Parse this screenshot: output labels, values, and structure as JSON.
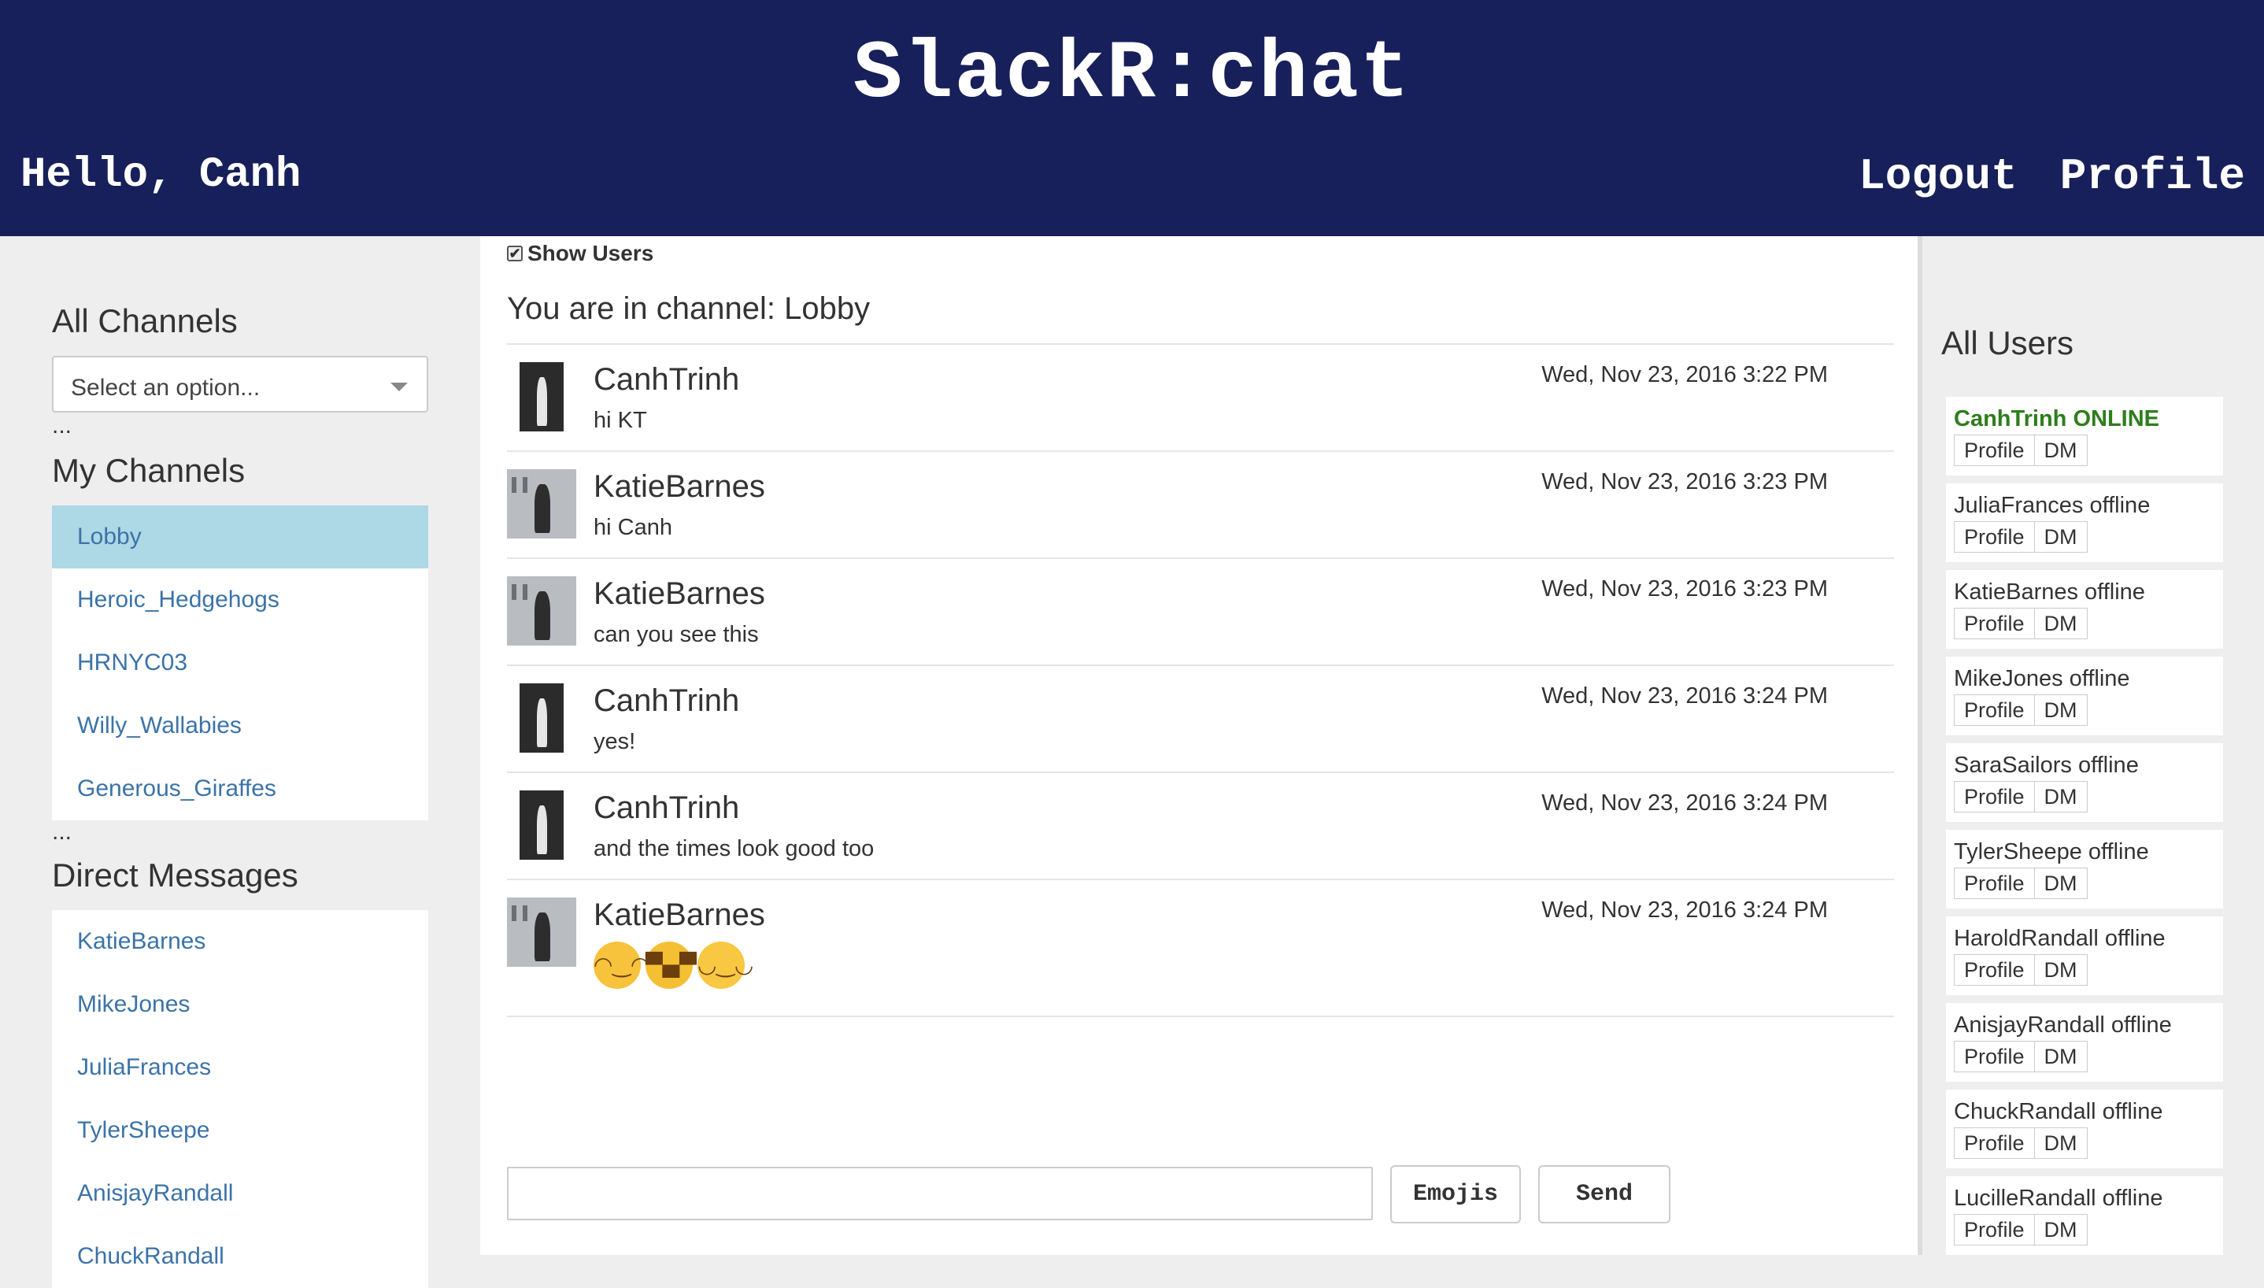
{
  "header": {
    "title": "SlackR:chat",
    "greeting": "Hello, Canh",
    "logout_label": "Logout",
    "profile_label": "Profile"
  },
  "sidebar": {
    "all_channels_title": "All Channels",
    "select_placeholder": "Select an option...",
    "dots": "...",
    "my_channels_title": "My Channels",
    "my_channels": [
      {
        "label": "Lobby",
        "active": true
      },
      {
        "label": "Heroic_Hedgehogs"
      },
      {
        "label": "HRNYC03"
      },
      {
        "label": "Willy_Wallabies"
      },
      {
        "label": "Generous_Giraffes"
      }
    ],
    "dots2": "...",
    "direct_messages_title": "Direct Messages",
    "direct_messages": [
      {
        "label": "KatieBarnes"
      },
      {
        "label": "MikeJones"
      },
      {
        "label": "JuliaFrances"
      },
      {
        "label": "TylerSheepe"
      },
      {
        "label": "AnisjayRandall"
      },
      {
        "label": "ChuckRandall"
      }
    ]
  },
  "main": {
    "show_users_label": "Show Users",
    "show_users_checked": true,
    "channel_heading": "You are in channel: Lobby",
    "messages": [
      {
        "user": "CanhTrinh",
        "text": "hi KT",
        "time": "Wed, Nov 23, 2016 3:22 PM",
        "avatar": "canh"
      },
      {
        "user": "KatieBarnes",
        "text": "hi Canh",
        "time": "Wed, Nov 23, 2016 3:23 PM",
        "avatar": "katie"
      },
      {
        "user": "KatieBarnes",
        "text": "can you see this",
        "time": "Wed, Nov 23, 2016 3:23 PM",
        "avatar": "katie"
      },
      {
        "user": "CanhTrinh",
        "text": "yes!",
        "time": "Wed, Nov 23, 2016 3:24 PM",
        "avatar": "canh"
      },
      {
        "user": "CanhTrinh",
        "text": "and the times look good too",
        "time": "Wed, Nov 23, 2016 3:24 PM",
        "avatar": "canh"
      },
      {
        "user": "KatieBarnes",
        "emojis": [
          "face-with-tears-of-joy-icon",
          "grimacing-face-icon",
          "face-savoring-food-icon"
        ],
        "time": "Wed, Nov 23, 2016 3:24 PM",
        "avatar": "katie"
      }
    ],
    "input_value": "",
    "emojis_button": "Emojis",
    "send_button": "Send"
  },
  "users_panel": {
    "title": "All Users",
    "profile_label": "Profile",
    "dm_label": "DM",
    "users": [
      {
        "label": "CanhTrinh ONLINE",
        "online": true
      },
      {
        "label": "JuliaFrances offline"
      },
      {
        "label": "KatieBarnes offline"
      },
      {
        "label": "MikeJones offline"
      },
      {
        "label": "SaraSailors offline"
      },
      {
        "label": "TylerSheepe offline"
      },
      {
        "label": "HaroldRandall offline"
      },
      {
        "label": "AnisjayRandall offline"
      },
      {
        "label": "ChuckRandall offline"
      },
      {
        "label": "LucilleRandall offline"
      }
    ]
  },
  "colors": {
    "header_bg": "#17205a",
    "link": "#3b73a8",
    "active_channel_bg": "#add8e6",
    "online": "#2e7d1c"
  }
}
